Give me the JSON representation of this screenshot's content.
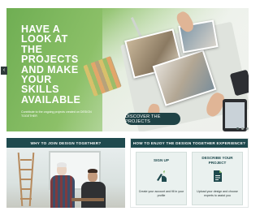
{
  "hero": {
    "title": "HAVE A\nLOOK AT\nTHE\nPROJECTS\nAND MAKE\nYOUR\nSKILLS\nAVAILABLE",
    "subtitle": "Contribute to the ongoing projects created on DESIGN TOGETHER",
    "cta_label": "DISCOVER THE PROJECTS",
    "prev_arrow": "‹",
    "slides": 3,
    "active_slide": 1,
    "colors": {
      "accent": "#7ab55c",
      "cta_bg": "#1f4346"
    }
  },
  "panels": {
    "why": {
      "heading": "WHY TO JOIN DESIGN TOGETHER?"
    },
    "how": {
      "heading": "HOW TO ENJOY THE DESIGN TOGETHER EXPERIENCE?",
      "steps": [
        {
          "title": "SIGN UP",
          "icon": "pen-hand-icon",
          "text": "Create your account and fill in your profile"
        },
        {
          "title": "DESCRIBE YOUR PROJECT",
          "icon": "document-icon",
          "text": "Upload your design and choose experts to assist you"
        }
      ]
    }
  },
  "colors": {
    "bar": "#1f4a4e"
  }
}
